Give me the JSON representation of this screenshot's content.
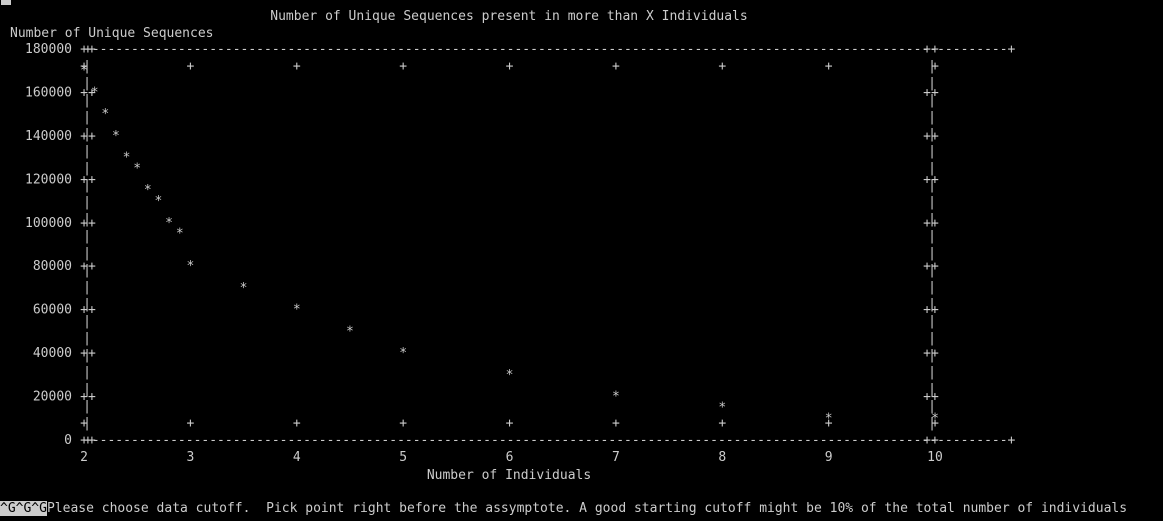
{
  "terminal": {
    "colors": {
      "background": "#000000",
      "foreground": "#cccccc"
    },
    "prompt": {
      "ctrl_echo": "^G^G^G",
      "message": "Please choose data cutoff.  Pick point right before the assymptote. A good starting cutoff might be 10% of the total number of individuals"
    }
  },
  "chart_data": {
    "type": "line",
    "title": "Number of Unique Sequences present in more than X Individuals",
    "xlabel": "Number of Individuals",
    "ylabel": "Number of Unique Sequences",
    "xlim": [
      2,
      10
    ],
    "ylim": [
      0,
      180000
    ],
    "x_ticks": [
      "2",
      "3",
      "4",
      "5",
      "6",
      "7",
      "8",
      "9",
      "10"
    ],
    "y_ticks": [
      "0",
      "20000",
      "40000",
      "60000",
      "80000",
      "100000",
      "120000",
      "140000",
      "160000",
      "180000"
    ],
    "marker": "*",
    "x": [
      2.0,
      2.1,
      2.2,
      2.3,
      2.4,
      2.5,
      2.6,
      2.7,
      2.8,
      2.9,
      3.0,
      3.5,
      4.0,
      4.5,
      5.0,
      6.0,
      7.0,
      8.0,
      9.0,
      10.0
    ],
    "values": [
      170000,
      160000,
      150000,
      140000,
      130000,
      125000,
      115000,
      110000,
      100000,
      95000,
      80000,
      70000,
      60000,
      50000,
      40000,
      30000,
      20000,
      15000,
      10000,
      10000
    ]
  }
}
